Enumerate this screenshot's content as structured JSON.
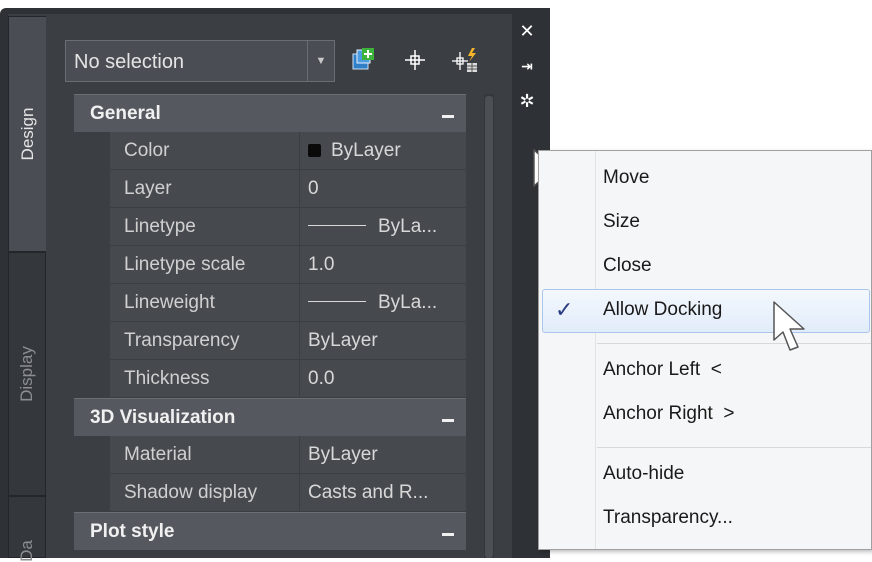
{
  "selector": {
    "value": "No selection"
  },
  "toolbar": {
    "icons": [
      "quick-select-icon",
      "select-objects-icon",
      "toggle-pickadd-icon"
    ]
  },
  "tabs": [
    {
      "label": "Design"
    },
    {
      "label": "Display"
    },
    {
      "label": "Da"
    }
  ],
  "categories": {
    "general": {
      "label": "General",
      "rows": [
        {
          "name": "Color",
          "value": "ByLayer"
        },
        {
          "name": "Layer",
          "value": "0"
        },
        {
          "name": "Linetype",
          "value": "ByLa..."
        },
        {
          "name": "Linetype scale",
          "value": "1.0"
        },
        {
          "name": "Lineweight",
          "value": "ByLa..."
        },
        {
          "name": "Transparency",
          "value": "ByLayer"
        },
        {
          "name": "Thickness",
          "value": "0.0"
        }
      ]
    },
    "visualization": {
      "label": "3D Visualization",
      "rows": [
        {
          "name": "Material",
          "value": "ByLayer"
        },
        {
          "name": "Shadow display",
          "value": "Casts and R..."
        }
      ]
    },
    "plot": {
      "label": "Plot style"
    }
  },
  "titlebar": {
    "close": "✕",
    "autohide": "⇥",
    "properties": "✲"
  },
  "menu": {
    "items": [
      {
        "label": "Move"
      },
      {
        "label": "Size"
      },
      {
        "label": "Close"
      },
      {
        "label": "Allow Docking",
        "checked": true
      },
      {
        "label": "Anchor Left  <"
      },
      {
        "label": "Anchor Right  >"
      },
      {
        "label": "Auto-hide"
      },
      {
        "label": "Transparency..."
      }
    ],
    "check_glyph": "✓"
  },
  "colors": {
    "accent_check": "#2a3c82",
    "highlight_border": "#aac6ec",
    "panel_bg": "#3b3e43"
  }
}
